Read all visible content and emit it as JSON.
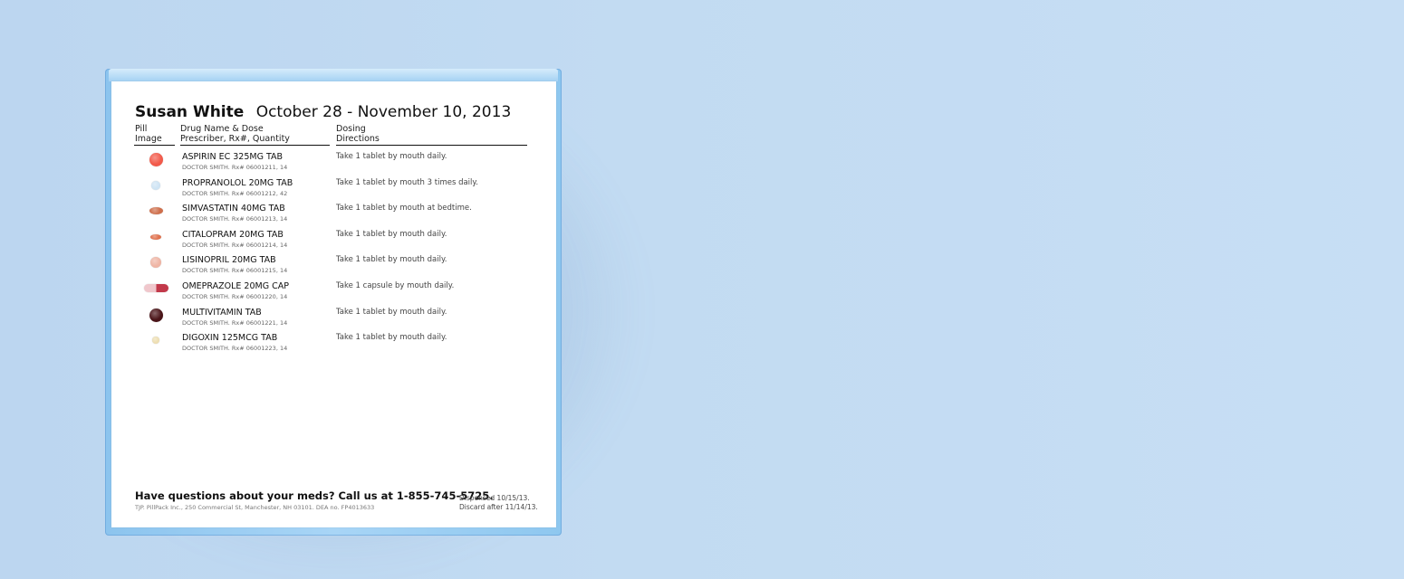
{
  "label": {
    "patient_name": "Susan White",
    "date_range": "October 28 - November 10, 2013",
    "columns": {
      "pill_1": "Pill",
      "pill_2": "Image",
      "drug_1": "Drug Name & Dose",
      "drug_2": "Prescriber, Rx#, Quantity",
      "dose_1": "Dosing",
      "dose_2": "Directions"
    },
    "meds": [
      {
        "drug": "ASPIRIN EC 325MG TAB",
        "prescriber": "DOCTOR SMITH. Rx# 06001211, 14",
        "directions": "Take 1 tablet by mouth daily.",
        "pill_color": "#f25a4a",
        "pill_color2": "#f25a4a",
        "pill_shape": "round-lg"
      },
      {
        "drug": "PROPRANOLOL 20MG TAB",
        "prescriber": "DOCTOR SMITH. Rx# 06001212, 42",
        "directions": "Take 1 tablet by mouth 3 times daily.",
        "pill_color": "#cfe4f4",
        "pill_color2": "#cfe4f4",
        "pill_shape": "round-sm"
      },
      {
        "drug": "SIMVASTATIN 40MG TAB",
        "prescriber": "DOCTOR SMITH. Rx# 06001213, 14",
        "directions": "Take 1 tablet by mouth at bedtime.",
        "pill_color": "#cf6f4c",
        "pill_color2": "#cf6f4c",
        "pill_shape": "oval"
      },
      {
        "drug": "CITALOPRAM 20MG TAB",
        "prescriber": "DOCTOR SMITH. Rx# 06001214, 14",
        "directions": "Take 1 tablet by mouth daily.",
        "pill_color": "#e0724e",
        "pill_color2": "#e0724e",
        "pill_shape": "oval-sm"
      },
      {
        "drug": "LISINOPRIL 20MG TAB",
        "prescriber": "DOCTOR SMITH. Rx# 06001215, 14",
        "directions": "Take 1 tablet by mouth daily.",
        "pill_color": "#efb5a5",
        "pill_color2": "#efb5a5",
        "pill_shape": "round-md"
      },
      {
        "drug": "OMEPRAZOLE 20MG CAP",
        "prescriber": "DOCTOR SMITH. Rx# 06001220, 14",
        "directions": "Take 1 capsule by mouth daily.",
        "pill_color": "#f0c7cc",
        "pill_color2": "#c2394a",
        "pill_shape": "capsule"
      },
      {
        "drug": "MULTIVITAMIN TAB",
        "prescriber": "DOCTOR SMITH. Rx# 06001221, 14",
        "directions": "Take 1 tablet by mouth daily.",
        "pill_color": "#4a1418",
        "pill_color2": "#4a1418",
        "pill_shape": "round-lg"
      },
      {
        "drug": "DIGOXIN 125MCG TAB",
        "prescriber": "DOCTOR SMITH. Rx# 06001223, 14",
        "directions": "Take 1 tablet by mouth daily.",
        "pill_color": "#eedfb3",
        "pill_color2": "#eedfb3",
        "pill_shape": "round-xs"
      }
    ],
    "footer_question": "Have questions about your meds? Call us at 1-855-745-5725.",
    "footer_address": "TJP. PillPack Inc., 250 Commercial St, Manchester, NH 03101. DEA no. FP4013633",
    "dispensed": "Dispensed 10/15/13.",
    "discard": "Discard after 11/14/13."
  }
}
